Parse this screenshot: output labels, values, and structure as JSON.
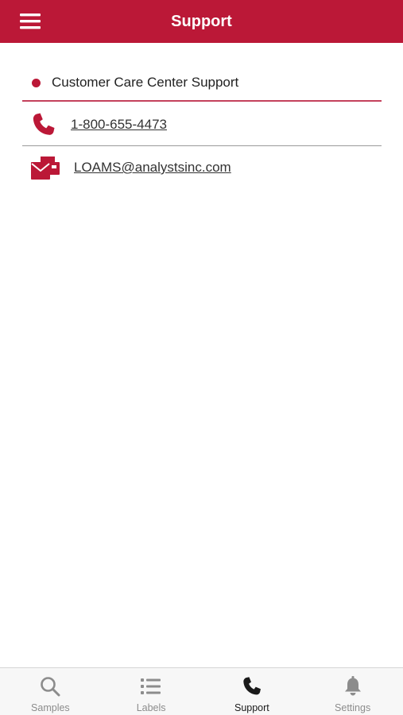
{
  "header": {
    "title": "Support",
    "menu_icon": "hamburger-menu-icon",
    "background": "#bb1837"
  },
  "support": {
    "section_title": "Customer Care Center Support",
    "phone": {
      "icon": "phone-icon",
      "value": "1-800-655-4473"
    },
    "email": {
      "icon": "email-icon",
      "value": "LOAMS@analystsinc.com"
    }
  },
  "tabbar": {
    "tabs": [
      {
        "label": "Samples",
        "icon": "search-icon",
        "active": false
      },
      {
        "label": "Labels",
        "icon": "list-icon",
        "active": false
      },
      {
        "label": "Support",
        "icon": "phone-icon",
        "active": true
      },
      {
        "label": "Settings",
        "icon": "bell-icon",
        "active": false
      }
    ]
  },
  "colors": {
    "accent": "#bb1837",
    "inactive_tab": "#8c8c8c",
    "active_tab": "#1a1a1a"
  }
}
